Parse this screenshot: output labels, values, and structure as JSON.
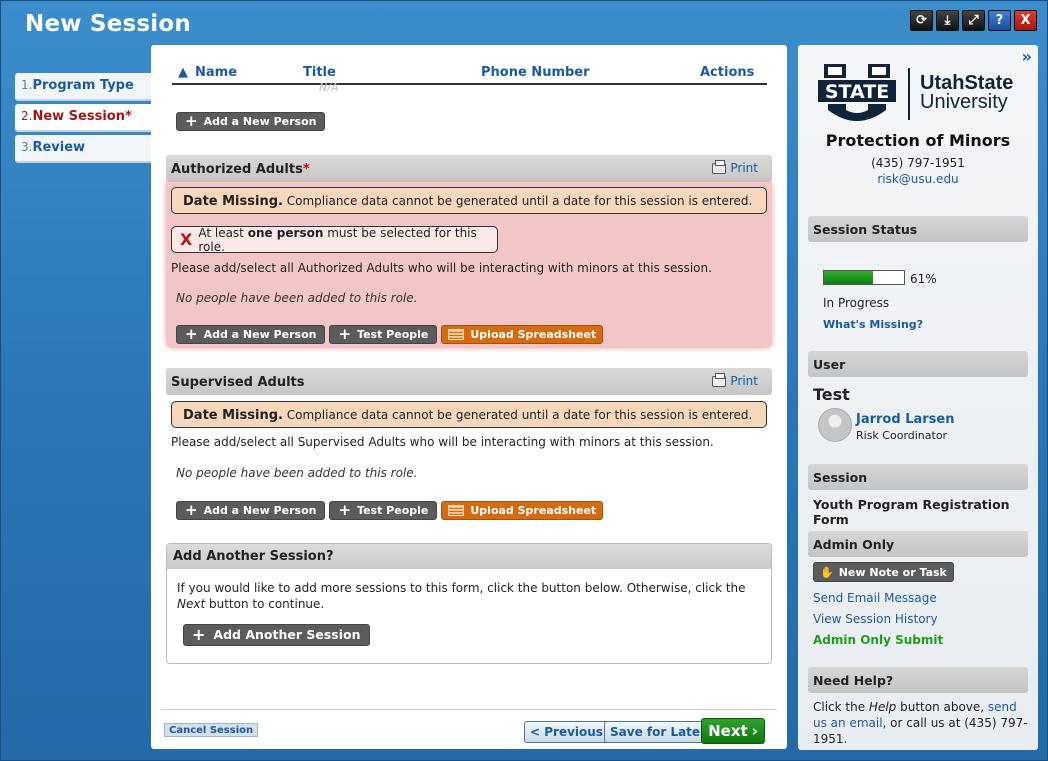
{
  "window": {
    "title": "New Session",
    "controls": [
      "refresh-icon",
      "download-icon",
      "expand-icon",
      "help-icon",
      "close-icon"
    ]
  },
  "steps": [
    {
      "num": "1.",
      "label": "Program Type"
    },
    {
      "num": "2.",
      "label": "New Session*"
    },
    {
      "num": "3.",
      "label": "Review"
    }
  ],
  "people_table": {
    "headers": {
      "name": "Name",
      "title": "Title",
      "phone": "Phone Number",
      "actions": "Actions"
    },
    "ghost_value": "N/A",
    "add_button": "Add a New Person"
  },
  "authorized": {
    "title": "Authorized Adults",
    "required_mark": "*",
    "print": "Print",
    "warning_bold": "Date Missing.",
    "warning_text": " Compliance data cannot be generated until a date for this session is entered.",
    "error_pre": "At least ",
    "error_bold": "one person",
    "error_post": " must be selected for this role.",
    "instruction": "Please add/select all Authorized Adults who will be interacting with minors at this session.",
    "empty": "No people have been added to this role.",
    "buttons": {
      "add": "Add a New Person",
      "test": "Test People",
      "upload": "Upload Spreadsheet"
    }
  },
  "supervised": {
    "title": "Supervised Adults",
    "print": "Print",
    "warning_bold": "Date Missing.",
    "warning_text": " Compliance data cannot be generated until a date for this session is entered.",
    "instruction": "Please add/select all Supervised Adults who will be interacting with minors at this session.",
    "empty": "No people have been added to this role.",
    "buttons": {
      "add": "Add a New Person",
      "test": "Test People",
      "upload": "Upload Spreadsheet"
    }
  },
  "add_session": {
    "title": "Add Another Session?",
    "text_pre": "If you would like to add more sessions to this form, click the button below. Otherwise, click the ",
    "text_italic": "Next",
    "text_post": " button to continue.",
    "button": "Add Another Session"
  },
  "footer": {
    "cancel": "Cancel Session",
    "previous": "< Previous",
    "save": "Save for Later",
    "next": "Next"
  },
  "sidebar": {
    "collapse": "»",
    "logo": {
      "state": "STATE",
      "line1": "UtahState",
      "line2": "University"
    },
    "org_title": "Protection of Minors",
    "phone": "(435) 797-1951",
    "email": "risk@usu.edu",
    "status_header": "Session Status",
    "progress_percent": 61,
    "progress_label": "61%",
    "status_text": "In Progress",
    "whats_missing": "What's Missing?",
    "user_header": "User",
    "user_group": "Test",
    "user_name": "Jarrod Larsen",
    "user_role": "Risk Coordinator",
    "session_header": "Session",
    "session_form": "Youth Program Registration Form",
    "admin_header": "Admin Only",
    "new_note": "New Note or Task",
    "send_email": "Send Email Message",
    "view_history": "View Session History",
    "admin_submit": "Admin Only Submit",
    "help_header": "Need Help?",
    "help_pre": "Click the ",
    "help_italic": "Help",
    "help_mid": " button above, ",
    "help_link": "send us an email",
    "help_post": ", or call us at (435) 797-1951."
  },
  "colors": {
    "accent_blue": "#1a5aa0",
    "active_step": "#a21818",
    "admin_green": "#1e9e1e",
    "orange": "#d46a12"
  }
}
